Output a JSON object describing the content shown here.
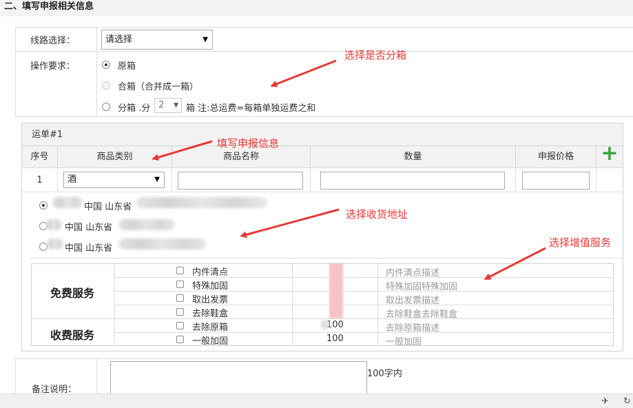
{
  "section": {
    "title": "二、填写申报相关信息"
  },
  "route": {
    "label": "线路选择：",
    "selected": "请选择"
  },
  "operation": {
    "label": "操作要求：",
    "options": [
      {
        "label": "原箱"
      },
      {
        "label": "合箱（合并成一箱）"
      },
      {
        "prefix": "分箱 .分",
        "count": "2",
        "suffix": "箱 注:总运费=每箱单独运费之和"
      }
    ]
  },
  "annotations": {
    "split_box": "选择是否分箱",
    "declare_info": "填写申报信息",
    "address": "选择收货地址",
    "value_added": "选择增值服务"
  },
  "waybill": {
    "title": "运单#1",
    "headers": [
      "序号",
      "商品类别",
      "商品名称",
      "数量",
      "申报价格"
    ],
    "row": {
      "index": "1",
      "category": "酒",
      "name": "",
      "quantity": "",
      "price": ""
    }
  },
  "addresses": [
    {
      "text": "中国 山东省"
    },
    {
      "text": "中国 山东省"
    },
    {
      "text": "中国 山东省"
    }
  ],
  "services": {
    "free_group": "免费服务",
    "paid_group": "收费服务",
    "items": [
      {
        "name": "内件清点",
        "price": "",
        "desc": "内件清点描述"
      },
      {
        "name": "特殊加固",
        "price": "",
        "desc": "特殊加固特殊加固"
      },
      {
        "name": "取出发票",
        "price": "",
        "desc": "取出发票描述"
      },
      {
        "name": "去除鞋盒",
        "price": "",
        "desc": "去除鞋盒去除鞋盒"
      },
      {
        "name": "去除原箱",
        "price": "100",
        "desc": "去除原箱描述"
      },
      {
        "name": "一般加固",
        "price": "100",
        "desc": "一般加固"
      }
    ]
  },
  "remark": {
    "label": "备注说明：",
    "hint": "100字内"
  },
  "colors": {
    "annotation": "#e53935",
    "add_icon": "#3aa43a",
    "pink_mask": "#f8c3c5"
  },
  "icons": [
    "plus-icon",
    "pin-icon",
    "refresh-icon"
  ]
}
